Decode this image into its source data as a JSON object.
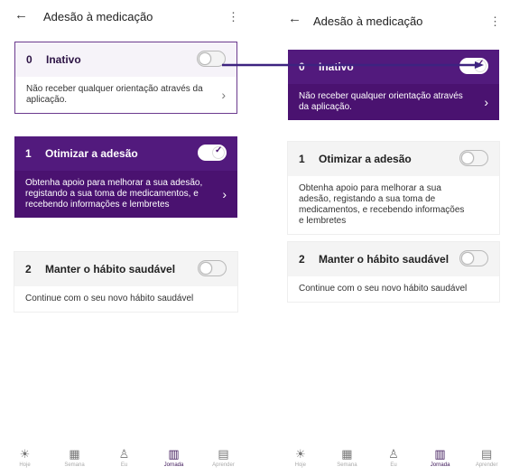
{
  "left_screen": {
    "header": {
      "back_icon": "arrow-left-icon",
      "title": "Adesão à medicação",
      "more_icon": "more-vertical-icon"
    },
    "options": [
      {
        "number": "0",
        "title": "Inativo",
        "description": "Não receber qualquer orientação através da aplicação.",
        "toggle": "off"
      },
      {
        "number": "1",
        "title": "Otimizar a adesão",
        "description": "Obtenha apoio para melhorar a sua adesão, registando a sua toma de medicamentos, e recebendo informações e lembretes",
        "toggle": "on"
      },
      {
        "number": "2",
        "title": "Manter o hábito saudável",
        "description": "Continue com o seu novo hábito saudável",
        "toggle": "off"
      }
    ],
    "nav": [
      {
        "label": "Hoje",
        "icon": "sun-icon"
      },
      {
        "label": "Semana",
        "icon": "calendar-icon"
      },
      {
        "label": "Eu",
        "icon": "person-icon"
      },
      {
        "label": "Jornada",
        "icon": "map-icon",
        "active": true
      },
      {
        "label": "Aprender",
        "icon": "book-icon"
      }
    ]
  },
  "right_screen": {
    "header": {
      "back_icon": "arrow-left-icon",
      "title": "Adesão à medicação",
      "more_icon": "more-vertical-icon"
    },
    "options": [
      {
        "number": "0",
        "title": "Inativo",
        "description": "Não receber qualquer orientação através da aplicação.",
        "toggle": "on"
      },
      {
        "number": "1",
        "title": "Otimizar a adesão",
        "description": "Obtenha apoio para melhorar a sua adesão, registando a sua toma de medicamentos, e recebendo informações e lembretes",
        "toggle": "off"
      },
      {
        "number": "2",
        "title": "Manter o hábito saudável",
        "description": "Continue com o seu novo hábito saudável",
        "toggle": "off"
      }
    ],
    "nav": [
      {
        "label": "Hoje",
        "icon": "sun-icon"
      },
      {
        "label": "Semana",
        "icon": "calendar-icon"
      },
      {
        "label": "Eu",
        "icon": "person-icon"
      },
      {
        "label": "Jornada",
        "icon": "map-icon",
        "active": true
      },
      {
        "label": "Aprender",
        "icon": "book-icon"
      }
    ]
  },
  "colors": {
    "purple": "#4a1270",
    "purple_header": "#521a7d",
    "connector": "#3d2380"
  }
}
